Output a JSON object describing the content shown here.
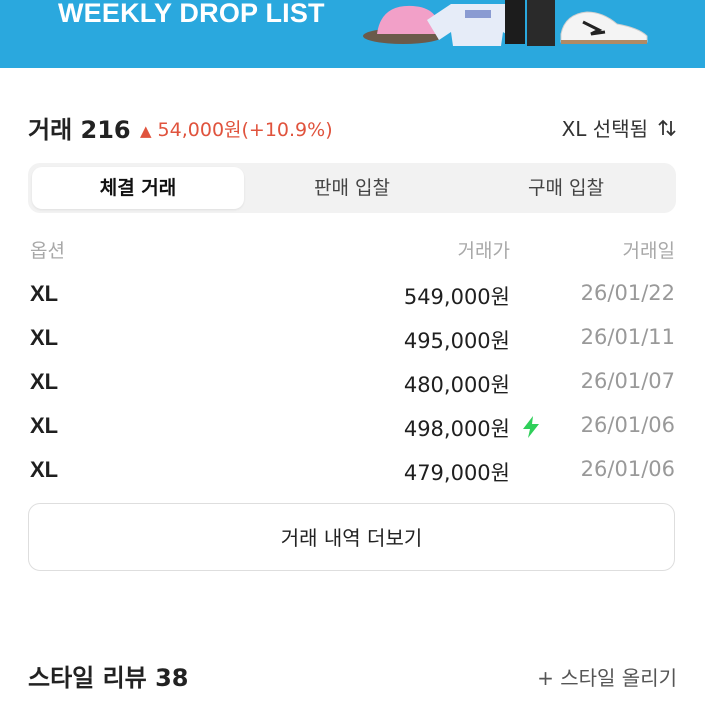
{
  "banner": {
    "title": "WEEKLY DROP LIST"
  },
  "trade": {
    "title": "거래 216",
    "change_arrow": "▲",
    "change_text": "54,000원(+10.9%)",
    "change_color": "#e0533d",
    "size_filter": "XL 선택됨",
    "sort_icon": "sort-updown-icon"
  },
  "tabs": [
    {
      "label": "체결 거래",
      "active": true
    },
    {
      "label": "판매 입찰",
      "active": false
    },
    {
      "label": "구매 입찰",
      "active": false
    }
  ],
  "table": {
    "headers": {
      "option": "옵션",
      "price": "거래가",
      "date": "거래일"
    },
    "rows": [
      {
        "size": "XL",
        "price": "549,000원",
        "date": "26/01/22",
        "bolt": false
      },
      {
        "size": "XL",
        "price": "495,000원",
        "date": "26/01/11",
        "bolt": false
      },
      {
        "size": "XL",
        "price": "480,000원",
        "date": "26/01/07",
        "bolt": false
      },
      {
        "size": "XL",
        "price": "498,000원",
        "date": "26/01/06",
        "bolt": true
      },
      {
        "size": "XL",
        "price": "479,000원",
        "date": "26/01/06",
        "bolt": false
      }
    ]
  },
  "more_button": "거래 내역 더보기",
  "style_review": {
    "title": "스타일 리뷰 38",
    "upload": "+ 스타일 올리기"
  },
  "colors": {
    "banner": "#2aa8de",
    "bolt": "#2fcf5a"
  }
}
